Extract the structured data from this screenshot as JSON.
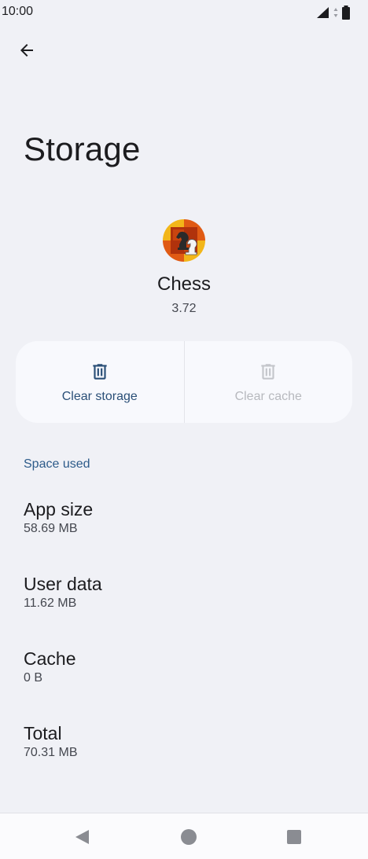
{
  "status_bar": {
    "time": "10:00"
  },
  "header": {
    "title": "Storage"
  },
  "app": {
    "name": "Chess",
    "version": "3.72"
  },
  "actions": {
    "clear_storage_label": "Clear storage",
    "clear_cache_label": "Clear cache"
  },
  "space_used": {
    "header": "Space used",
    "items": [
      {
        "label": "App size",
        "value": "58.69 MB"
      },
      {
        "label": "User data",
        "value": "11.62 MB"
      },
      {
        "label": "Cache",
        "value": "0 B"
      },
      {
        "label": "Total",
        "value": "70.31 MB"
      }
    ]
  },
  "colors": {
    "background": "#f0f1f6",
    "accent": "#2a4f77",
    "disabled": "#b7b9be"
  }
}
